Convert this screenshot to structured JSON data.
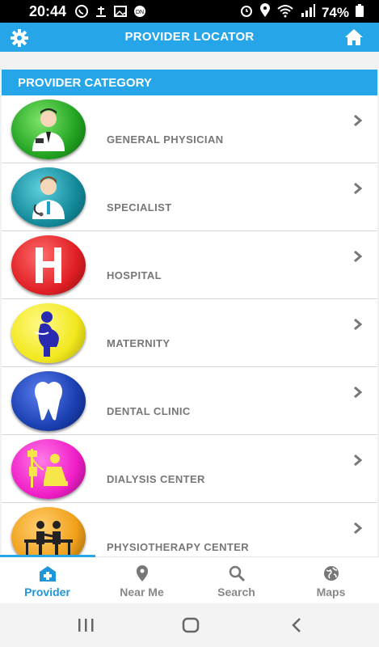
{
  "status_bar": {
    "time": "20:44",
    "battery_percent": "74%",
    "left_icons": [
      "whatsapp-icon",
      "notification-icon",
      "gallery-icon",
      "app-icon"
    ],
    "right_icons": [
      "alarm-icon",
      "location-icon",
      "wifi-icon",
      "signal-icon",
      "battery-icon"
    ]
  },
  "app_bar": {
    "title": "PROVIDER LOCATOR",
    "left_icon": "gear-icon",
    "right_icon": "home-icon",
    "color": "#26a6e8"
  },
  "category_header": "PROVIDER CATEGORY",
  "categories": [
    {
      "label": "GENERAL PHYSICIAN",
      "icon": "doctor-icon",
      "color": "#22a321"
    },
    {
      "label": "SPECIALIST",
      "icon": "specialist-doctor-icon",
      "color": "#138a9a"
    },
    {
      "label": "HOSPITAL",
      "icon": "hospital-h-icon",
      "color": "#e01f24"
    },
    {
      "label": "MATERNITY",
      "icon": "pregnant-woman-icon",
      "color": "#f2e81d"
    },
    {
      "label": "DENTAL CLINIC",
      "icon": "tooth-icon",
      "color": "#1a3fb0"
    },
    {
      "label": "DIALYSIS CENTER",
      "icon": "dialysis-icon",
      "color": "#f01ec8"
    },
    {
      "label": "PHYSIOTHERAPY CENTER",
      "icon": "physiotherapy-icon",
      "color": "#f0a01a"
    }
  ],
  "bottom_nav": {
    "items": [
      {
        "label": "Provider",
        "icon": "hospital-icon",
        "active": true
      },
      {
        "label": "Near Me",
        "icon": "location-pin-icon",
        "active": false
      },
      {
        "label": "Search",
        "icon": "search-icon",
        "active": false
      },
      {
        "label": "Maps",
        "icon": "globe-icon",
        "active": false
      }
    ],
    "active_color": "#1f96d8"
  }
}
